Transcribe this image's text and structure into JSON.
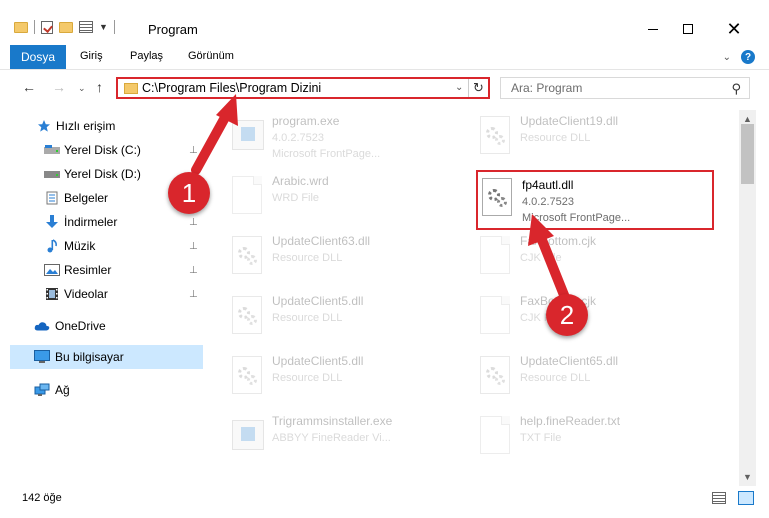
{
  "window": {
    "title": "Program",
    "minimize_icon": "minimize-icon",
    "maximize_icon": "maximize-icon",
    "close_glyph": "✕"
  },
  "ribbon": {
    "file_tab": "Dosya",
    "tabs": [
      "Giriş",
      "Paylaş",
      "Görünüm"
    ],
    "expand_glyph": "⌄",
    "help_glyph": "?"
  },
  "address": {
    "path": "C:\\Program Files\\Program Dizini",
    "dropdown_glyph": "⌄",
    "refresh_glyph": "↻",
    "search_placeholder": "Ara: Program",
    "search_glyph": "⚲"
  },
  "nav_buttons": {
    "back": "←",
    "forward": "→",
    "recent": "⌄",
    "up": "↑"
  },
  "sidebar": {
    "items": [
      {
        "label": "Hızlı erişim",
        "icon": "star-icon",
        "pinned": false
      },
      {
        "label": "Yerel Disk (C:)",
        "icon": "drive-icon",
        "pinned": true
      },
      {
        "label": "Yerel Disk (D:)",
        "icon": "drive-icon",
        "pinned": false
      },
      {
        "label": "Belgeler",
        "icon": "documents-icon",
        "pinned": true
      },
      {
        "label": "İndirmeler",
        "icon": "download-icon",
        "pinned": true
      },
      {
        "label": "Müzik",
        "icon": "music-icon",
        "pinned": true
      },
      {
        "label": "Resimler",
        "icon": "pictures-icon",
        "pinned": true
      },
      {
        "label": "Videolar",
        "icon": "video-icon",
        "pinned": true
      },
      {
        "label": "OneDrive",
        "icon": "onedrive-icon",
        "pinned": false
      },
      {
        "label": "Bu bilgisayar",
        "icon": "computer-icon",
        "pinned": false,
        "selected": true
      },
      {
        "label": "Ağ",
        "icon": "network-icon",
        "pinned": false
      }
    ],
    "pin_glyph": "📌"
  },
  "files": [
    {
      "name": "program.exe",
      "line1": "4.0.2.7523",
      "line2": "Microsoft FrontPage...",
      "icon": "exe-icon",
      "faded": true
    },
    {
      "name": "UpdateClient19.dll",
      "line1": "Resource DLL",
      "line2": "",
      "icon": "dll-icon",
      "faded": true
    },
    {
      "name": "Arabic.wrd",
      "line1": "WRD File",
      "line2": "",
      "icon": "file-icon",
      "faded": true
    },
    {
      "name": "fp4autl.dll",
      "line1": "4.0.2.7523",
      "line2": "Microsoft FrontPage...",
      "icon": "dll-icon",
      "faded": false,
      "highlighted": true
    },
    {
      "name": "UpdateClient63.dll",
      "line1": "Resource DLL",
      "line2": "",
      "icon": "dll-icon",
      "faded": true
    },
    {
      "name": "FaxBottom.cjk",
      "line1": "CJK File",
      "line2": "",
      "icon": "file-icon",
      "faded": true
    },
    {
      "name": "UpdateClient5.dll",
      "line1": "Resource DLL",
      "line2": "",
      "icon": "dll-icon",
      "faded": true
    },
    {
      "name": "FaxBottom.cjk",
      "line1": "CJK File",
      "line2": "",
      "icon": "file-icon",
      "faded": true
    },
    {
      "name": "UpdateClient5.dll",
      "line1": "Resource DLL",
      "line2": "",
      "icon": "dll-icon",
      "faded": true
    },
    {
      "name": "UpdateClient65.dll",
      "line1": "Resource DLL",
      "line2": "",
      "icon": "dll-icon",
      "faded": true
    },
    {
      "name": "Trigrammsinstaller.exe",
      "line1": "ABBYY FineReader Vi...",
      "line2": "",
      "icon": "exe-icon",
      "faded": true
    },
    {
      "name": "help.fineReader.txt",
      "line1": "TXT File",
      "line2": "",
      "icon": "file-icon",
      "faded": true
    }
  ],
  "status": {
    "item_count": "142 öğe"
  },
  "annotations": {
    "step1": "1",
    "step2": "2",
    "color": "#d9262c"
  },
  "colors": {
    "accent": "#1979ca",
    "highlight": "#d9262c",
    "selected_bg": "#cce8ff"
  }
}
